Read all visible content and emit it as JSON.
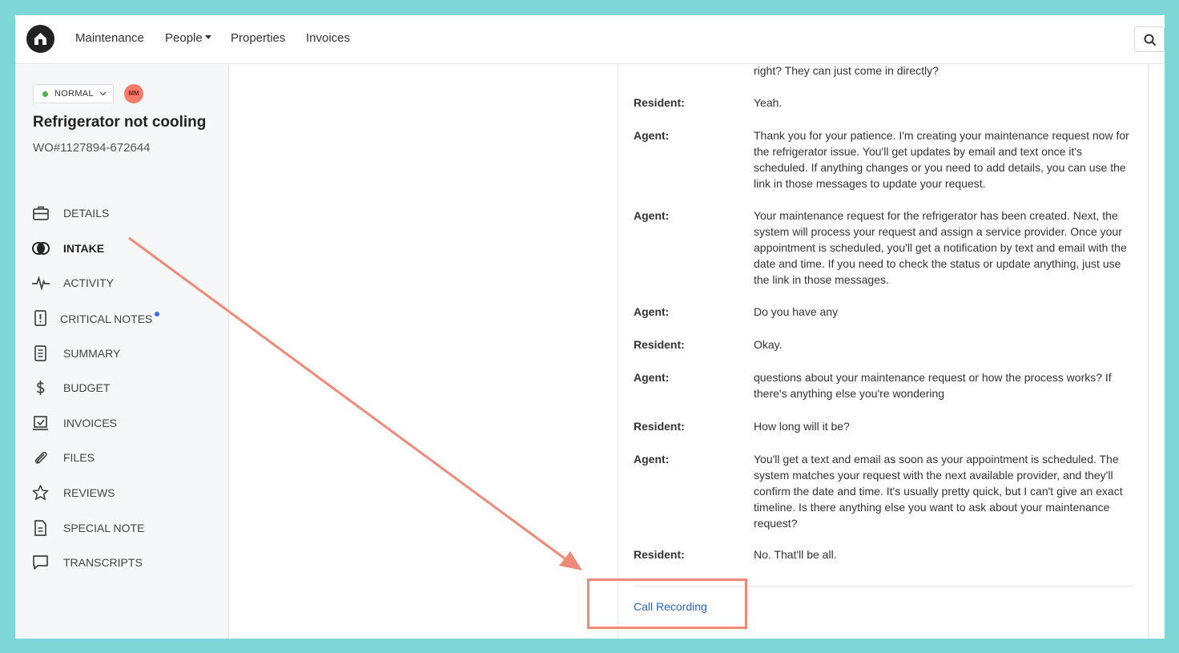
{
  "colors": {
    "accent": "#2d62c8",
    "annotation": "#f08a78",
    "status_normal": "#4caf50",
    "avatar_bg": "#f47b6a"
  },
  "nav": {
    "logo_icon": "home-icon",
    "links": [
      "Maintenance",
      "People",
      "Properties",
      "Invoices"
    ],
    "search_icon": "search-icon"
  },
  "workorder": {
    "priority": "NORMAL",
    "assignee_initials": "MM",
    "title": "Refrigerator not cooling",
    "number": "WO#1127894-672644"
  },
  "sidebar": {
    "items": [
      {
        "label": "DETAILS",
        "icon": "briefcase-icon"
      },
      {
        "label": "INTAKE",
        "icon": "intake-icon"
      },
      {
        "label": "ACTIVITY",
        "icon": "activity-icon"
      },
      {
        "label": "CRITICAL NOTES",
        "icon": "alert-file-icon"
      },
      {
        "label": "SUMMARY",
        "icon": "document-icon"
      },
      {
        "label": "BUDGET",
        "icon": "dollar-icon"
      },
      {
        "label": "INVOICES",
        "icon": "invoice-icon"
      },
      {
        "label": "FILES",
        "icon": "paperclip-icon"
      },
      {
        "label": "REVIEWS",
        "icon": "star-icon"
      },
      {
        "label": "SPECIAL NOTE",
        "icon": "note-icon"
      },
      {
        "label": "TRANSCRIPTS",
        "icon": "chat-icon"
      }
    ]
  },
  "transcript": {
    "partial_first": "right? They can just come in directly?",
    "messages": [
      {
        "speaker": "Resident:",
        "text": "Yeah."
      },
      {
        "speaker": "Agent:",
        "text": "Thank you for your patience. I'm creating your maintenance request now for the refrigerator issue. You'll get updates by email and text once it's scheduled. If anything changes or you need to add details, you can use the link in those messages to update your request."
      },
      {
        "speaker": "Agent:",
        "text": "Your maintenance request for the refrigerator has been created. Next, the system will process your request and assign a service provider. Once your appointment is scheduled, you'll get a notification by text and email with the date and time. If you need to check the status or update anything, just use the link in those messages."
      },
      {
        "speaker": "Agent:",
        "text": "Do you have any"
      },
      {
        "speaker": "Resident:",
        "text": "Okay."
      },
      {
        "speaker": "Agent:",
        "text": "questions about your maintenance request or how the process works? If there's anything else you're wondering"
      },
      {
        "speaker": "Resident:",
        "text": "How long will it be?"
      },
      {
        "speaker": "Agent:",
        "text": "You'll get a text and email as soon as your appointment is scheduled. The system matches your request with the next available provider, and they'll confirm the date and time. It's usually pretty quick, but I can't give an exact timeline. Is there anything else you want to ask about your maintenance request?"
      },
      {
        "speaker": "Resident:",
        "text": "No. That'll be all."
      }
    ],
    "call_recording_label": "Call Recording"
  }
}
